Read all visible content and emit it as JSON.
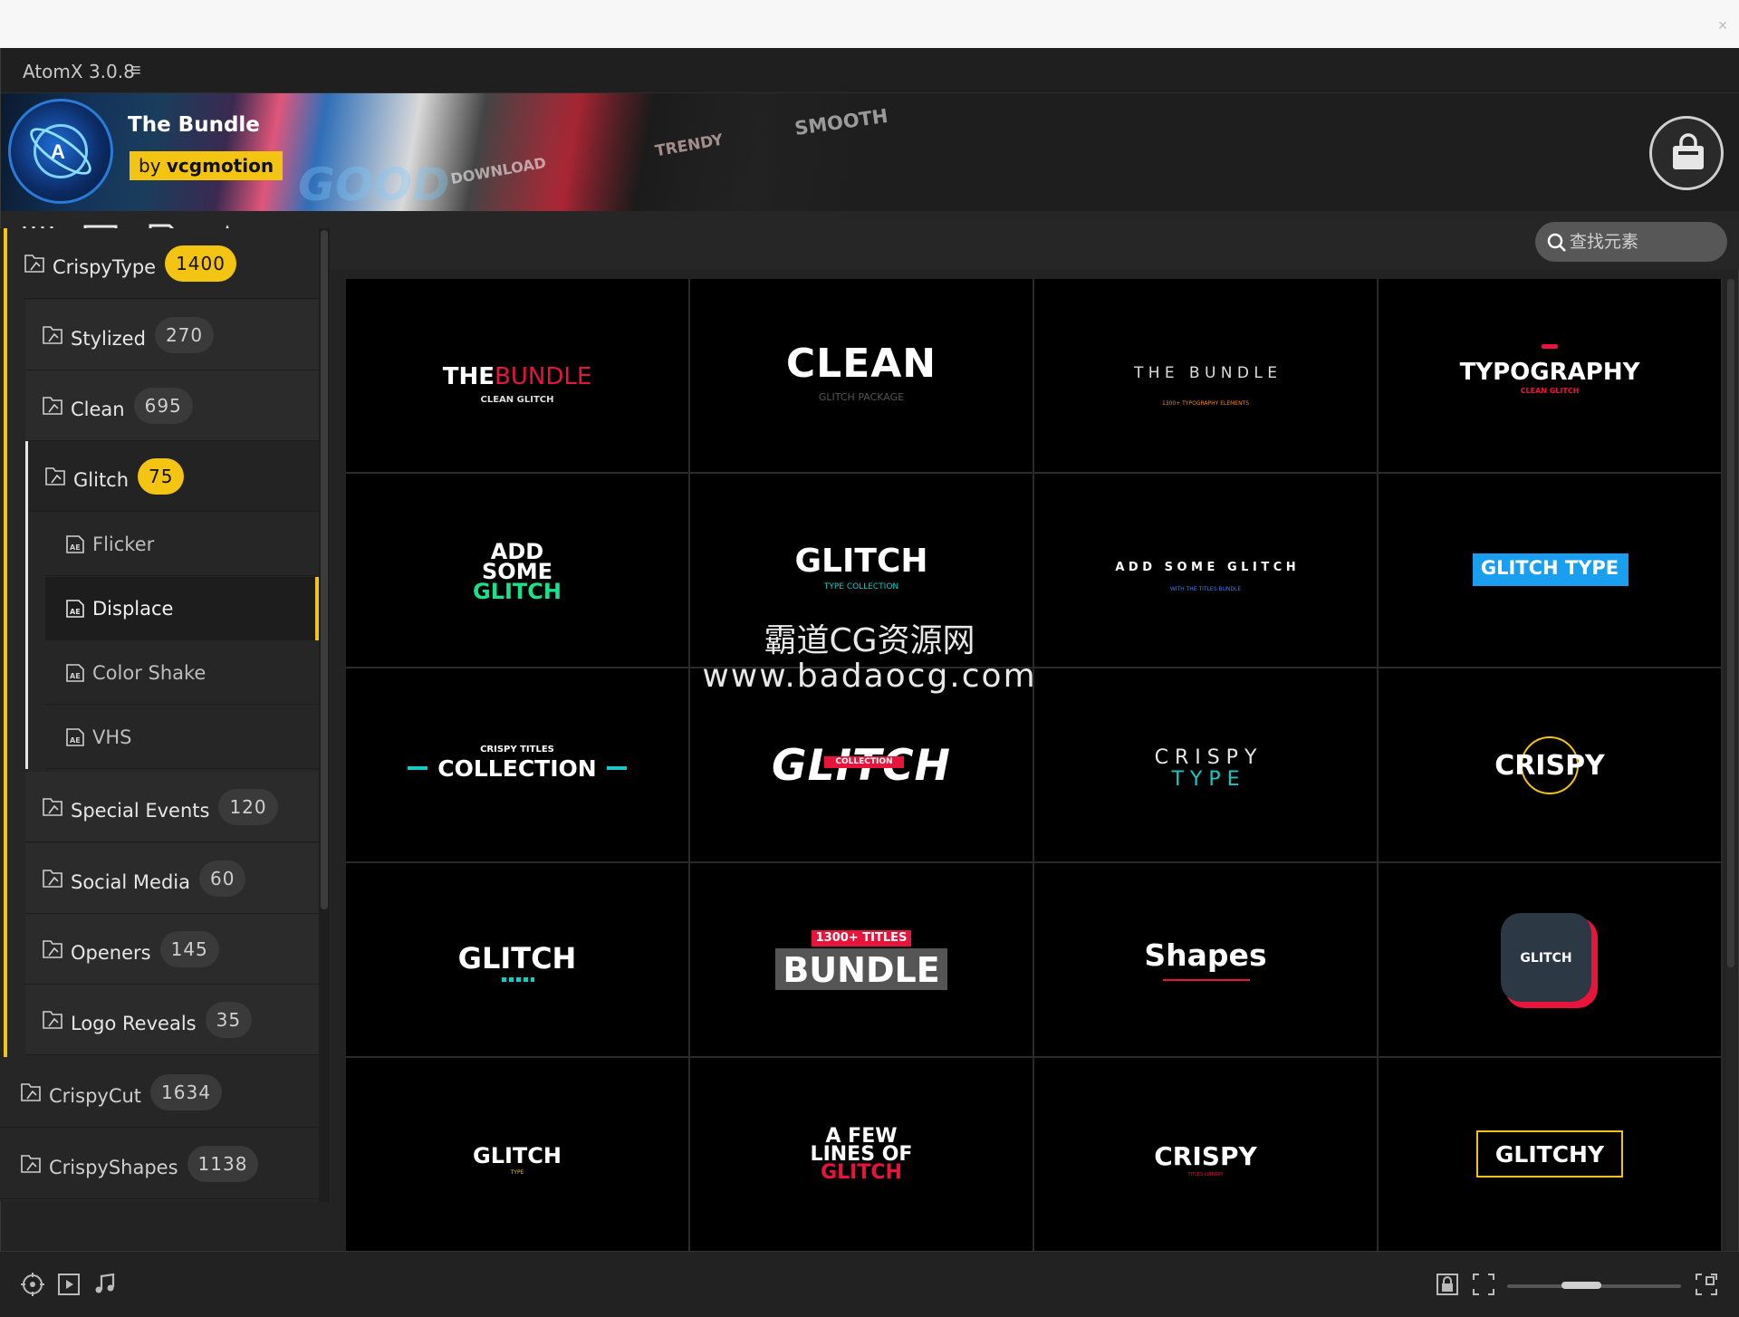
{
  "app": {
    "title": "AtomX 3.0.8",
    "menu_icon": "hamburger-icon"
  },
  "banner": {
    "title": "The Bundle",
    "by_prefix": "by",
    "by_name": "vcgmotion",
    "art_words": [
      "TRENDY",
      "SMOOTH",
      "DOWNLOAD",
      "GOOD"
    ]
  },
  "toolbar": {
    "icons": [
      "sliders-icon",
      "list-icon",
      "play-file-icon",
      "star-icon"
    ],
    "search": {
      "placeholder": "查找元素"
    }
  },
  "sidebar": {
    "crispytype": {
      "label": "CrispyType",
      "count": "1400"
    },
    "stylized": {
      "label": "Stylized",
      "count": "270"
    },
    "clean": {
      "label": "Clean",
      "count": "695"
    },
    "glitch": {
      "label": "Glitch",
      "count": "75"
    },
    "leaves": [
      "Flicker",
      "Displace",
      "Color Shake",
      "VHS"
    ],
    "special_events": {
      "label": "Special Events",
      "count": "120"
    },
    "social_media": {
      "label": "Social Media",
      "count": "60"
    },
    "openers": {
      "label": "Openers",
      "count": "145"
    },
    "logo_reveals": {
      "label": "Logo Reveals",
      "count": "35"
    },
    "crispycut": {
      "label": "CrispyCut",
      "count": "1634"
    },
    "crispyshapes": {
      "label": "CrispyShapes",
      "count": "1138"
    }
  },
  "tiles": {
    "t1": {
      "a": "THE",
      "b": "BUNDLE",
      "sub": "CLEAN GLITCH"
    },
    "t2": {
      "main": "CLEAN",
      "sub": "GLITCH PACKAGE"
    },
    "t3": {
      "main": "T H E   B U N D L E",
      "sub": "1300+ TYPOGRAPHY ELEMENTS"
    },
    "t4": {
      "main": "TYPOGRAPHY",
      "sub": "CLEAN GLITCH"
    },
    "t5": {
      "l1": "ADD",
      "l2": "SOME",
      "l3": "GLITCH"
    },
    "t6": {
      "main": "GLITCH",
      "sub": "TYPE COLLECTION"
    },
    "t7": {
      "main": "A D D   S O M E   G L I T C H",
      "sub": "WITH THE TITLES BUNDLE"
    },
    "t8": {
      "main": "GLITCH TYPE"
    },
    "t9": {
      "top": "CRISPY TITLES",
      "main": "COLLECTION"
    },
    "t10": {
      "main": "GLITCH",
      "tag": "COLLECTION"
    },
    "t11": {
      "l1": "C R I S P Y",
      "l2": "T Y P E"
    },
    "t12": {
      "main": "CRISPY"
    },
    "t13": {
      "main": "GLITCH"
    },
    "t14": {
      "tag": "1300+ TITLES",
      "main": "BUNDLE"
    },
    "t15": {
      "main": "Shapes"
    },
    "t16": {
      "main": "GLITCH"
    },
    "t17": {
      "main": "GLITCH",
      "sub": "TYPE"
    },
    "t18": {
      "l1": "A FEW",
      "l2": "LINES OF",
      "l3": "GLITCH"
    },
    "t19": {
      "main": "CRISPY",
      "sub": "TITLES LIBRARY"
    },
    "t20": {
      "main": "GLITCHY"
    }
  },
  "watermark": {
    "line1": "霸道CG资源网",
    "line2": "www.badaocg.com"
  },
  "bottombar": {
    "icons": [
      "target-icon",
      "video-icon",
      "music-icon",
      "lock-icon",
      "fit-icon",
      "expand-icon"
    ],
    "zoom": 0.5
  },
  "colors": {
    "accent_yellow": "#f3c512",
    "panel_bg": "#262626",
    "tile_bg": "#000000",
    "glitch_green": "#19e28a",
    "glitch_red": "#e8143c",
    "glitch_blue": "#1a9ef0"
  }
}
